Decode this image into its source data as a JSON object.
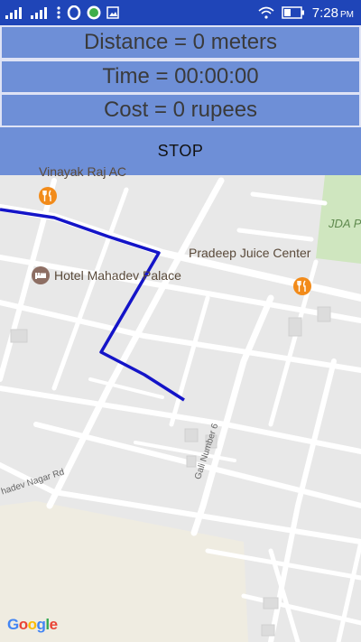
{
  "status_bar": {
    "time": "7:28",
    "ampm": "PM",
    "icons": [
      "signal-icon",
      "signal-icon-2",
      "menu-dots-icon",
      "opera-icon",
      "app-icon",
      "image-icon",
      "wifi-icon",
      "battery-icon"
    ]
  },
  "panel": {
    "distance": "Distance = 0 meters",
    "time": "Time = 00:00:00",
    "cost": "Cost = 0 rupees",
    "stop_label": "STOP"
  },
  "map": {
    "pois": [
      {
        "name": "Vinayak Raj AC",
        "icon": "restaurant-icon"
      },
      {
        "name": "Pradeep Juice Center",
        "icon": "restaurant-icon"
      },
      {
        "name": "Hotel Mahadev Palace",
        "icon": "hotel-icon"
      }
    ],
    "park_label": "JDA P",
    "roads": [
      "Gali Number 6",
      "hadev Nagar Rd"
    ],
    "route_color": "#1414c8",
    "google_logo": "Google"
  }
}
